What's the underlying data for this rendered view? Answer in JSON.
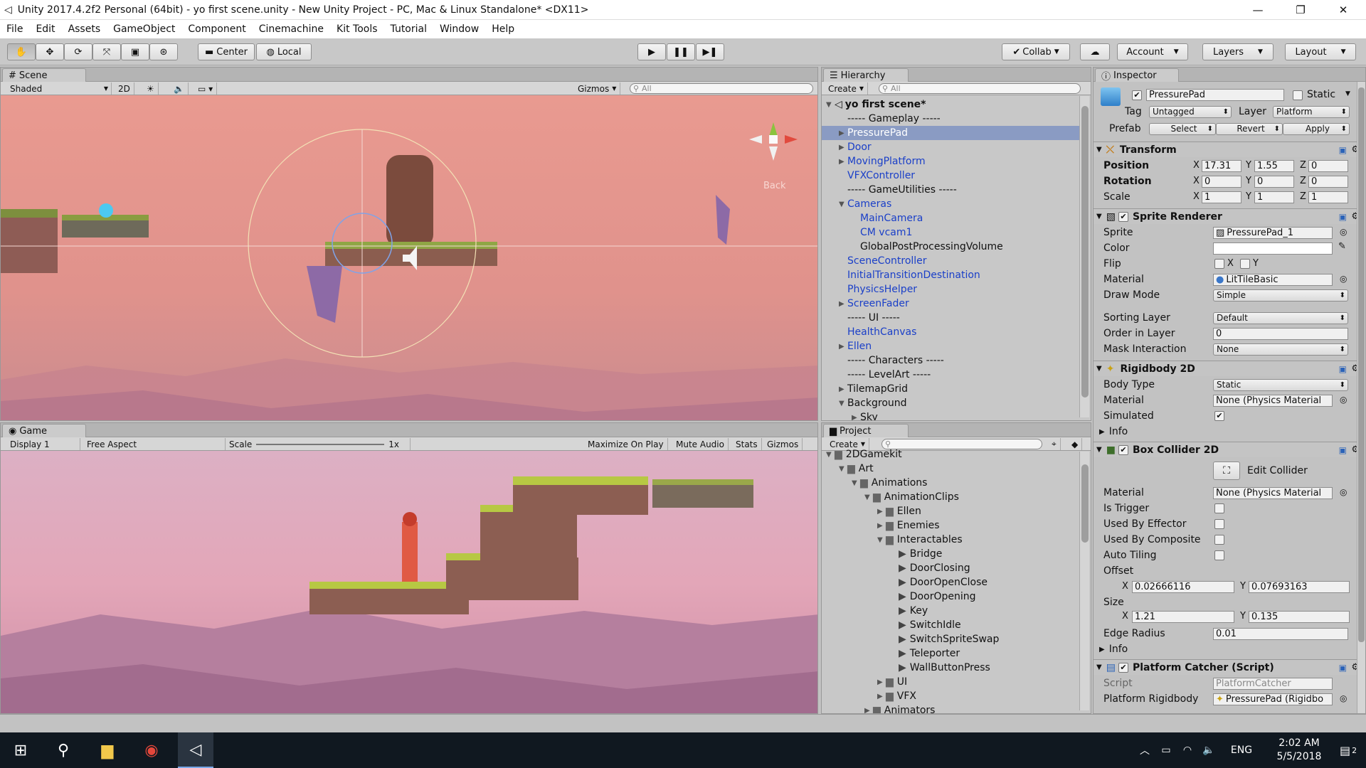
{
  "window": {
    "title": "Unity 2017.4.2f2 Personal (64bit) - yo first scene.unity - New Unity Project - PC, Mac & Linux Standalone* <DX11>"
  },
  "menu": [
    "File",
    "Edit",
    "Assets",
    "GameObject",
    "Component",
    "Cinemachine",
    "Kit Tools",
    "Tutorial",
    "Window",
    "Help"
  ],
  "toolbar": {
    "center": "Center",
    "local": "Local",
    "collab": "Collab",
    "account": "Account",
    "layers": "Layers",
    "layout": "Layout"
  },
  "scene": {
    "tab": "Scene",
    "shading": "Shaded",
    "mode2d": "2D",
    "gizmos": "Gizmos",
    "search_placeholder": "All",
    "back_label": "Back"
  },
  "game": {
    "tab": "Game",
    "display": "Display 1",
    "aspect": "Free Aspect",
    "scale_label": "Scale",
    "scale_value": "1x",
    "maximize": "Maximize On Play",
    "mute": "Mute Audio",
    "stats": "Stats",
    "gizmos": "Gizmos"
  },
  "hierarchy": {
    "tab": "Hierarchy",
    "create": "Create",
    "search_placeholder": "All",
    "scene_name": "yo first scene*",
    "items": [
      {
        "label": "----- Gameplay -----",
        "indent": 1,
        "arrow": "",
        "style": "plain"
      },
      {
        "label": "PressurePad",
        "indent": 1,
        "arrow": "▶",
        "style": "selected"
      },
      {
        "label": "Door",
        "indent": 1,
        "arrow": "▶",
        "style": "blue"
      },
      {
        "label": "MovingPlatform",
        "indent": 1,
        "arrow": "▶",
        "style": "blue"
      },
      {
        "label": "VFXController",
        "indent": 1,
        "arrow": "",
        "style": "blue"
      },
      {
        "label": "----- GameUtilities -----",
        "indent": 1,
        "arrow": "",
        "style": "plain"
      },
      {
        "label": "Cameras",
        "indent": 1,
        "arrow": "▼",
        "style": "blue"
      },
      {
        "label": "MainCamera",
        "indent": 2,
        "arrow": "",
        "style": "blue"
      },
      {
        "label": "CM vcam1",
        "indent": 2,
        "arrow": "",
        "style": "blue"
      },
      {
        "label": "GlobalPostProcessingVolume",
        "indent": 2,
        "arrow": "",
        "style": "plain"
      },
      {
        "label": "SceneController",
        "indent": 1,
        "arrow": "",
        "style": "blue"
      },
      {
        "label": "InitialTransitionDestination",
        "indent": 1,
        "arrow": "",
        "style": "blue"
      },
      {
        "label": "PhysicsHelper",
        "indent": 1,
        "arrow": "",
        "style": "blue"
      },
      {
        "label": "ScreenFader",
        "indent": 1,
        "arrow": "▶",
        "style": "blue"
      },
      {
        "label": "----- UI -----",
        "indent": 1,
        "arrow": "",
        "style": "plain"
      },
      {
        "label": "HealthCanvas",
        "indent": 1,
        "arrow": "",
        "style": "blue"
      },
      {
        "label": "Ellen",
        "indent": 1,
        "arrow": "▶",
        "style": "blue"
      },
      {
        "label": "----- Characters -----",
        "indent": 1,
        "arrow": "",
        "style": "plain"
      },
      {
        "label": "----- LevelArt -----",
        "indent": 1,
        "arrow": "",
        "style": "plain"
      },
      {
        "label": "TilemapGrid",
        "indent": 1,
        "arrow": "▶",
        "style": "plain"
      },
      {
        "label": "Background",
        "indent": 1,
        "arrow": "▼",
        "style": "plain"
      },
      {
        "label": "Sky",
        "indent": 2,
        "arrow": "▶",
        "style": "plain"
      }
    ]
  },
  "project": {
    "tab": "Project",
    "create": "Create",
    "items": [
      {
        "label": "2DGamekit",
        "indent": 0,
        "arrow": "▼",
        "icon": "folder"
      },
      {
        "label": "Art",
        "indent": 1,
        "arrow": "▼",
        "icon": "folder"
      },
      {
        "label": "Animations",
        "indent": 2,
        "arrow": "▼",
        "icon": "folder"
      },
      {
        "label": "AnimationClips",
        "indent": 3,
        "arrow": "▼",
        "icon": "folder"
      },
      {
        "label": "Ellen",
        "indent": 4,
        "arrow": "▶",
        "icon": "folder"
      },
      {
        "label": "Enemies",
        "indent": 4,
        "arrow": "▶",
        "icon": "folder"
      },
      {
        "label": "Interactables",
        "indent": 4,
        "arrow": "▼",
        "icon": "folder"
      },
      {
        "label": "Bridge",
        "indent": 5,
        "arrow": "",
        "icon": "clip"
      },
      {
        "label": "DoorClosing",
        "indent": 5,
        "arrow": "",
        "icon": "clip"
      },
      {
        "label": "DoorOpenClose",
        "indent": 5,
        "arrow": "",
        "icon": "clip"
      },
      {
        "label": "DoorOpening",
        "indent": 5,
        "arrow": "",
        "icon": "clip"
      },
      {
        "label": "Key",
        "indent": 5,
        "arrow": "",
        "icon": "clip"
      },
      {
        "label": "SwitchIdle",
        "indent": 5,
        "arrow": "",
        "icon": "clip"
      },
      {
        "label": "SwitchSpriteSwap",
        "indent": 5,
        "arrow": "",
        "icon": "clip"
      },
      {
        "label": "Teleporter",
        "indent": 5,
        "arrow": "",
        "icon": "clip"
      },
      {
        "label": "WallButtonPress",
        "indent": 5,
        "arrow": "",
        "icon": "clip"
      },
      {
        "label": "UI",
        "indent": 4,
        "arrow": "▶",
        "icon": "folder"
      },
      {
        "label": "VFX",
        "indent": 4,
        "arrow": "▶",
        "icon": "folder"
      },
      {
        "label": "Animators",
        "indent": 3,
        "arrow": "▶",
        "icon": "folder"
      }
    ]
  },
  "inspector": {
    "tab": "Inspector",
    "object_name": "PressurePad",
    "static_label": "Static",
    "tag_label": "Tag",
    "tag_value": "Untagged",
    "layer_label": "Layer",
    "layer_value": "Platform",
    "prefab_label": "Prefab",
    "select": "Select",
    "revert": "Revert",
    "apply": "Apply",
    "transform": {
      "title": "Transform",
      "position_label": "Position",
      "pos_x": "17.31",
      "pos_y": "1.55",
      "pos_z": "0",
      "rotation_label": "Rotation",
      "rot_x": "0",
      "rot_y": "0",
      "rot_z": "0",
      "scale_label": "Scale",
      "scale_x": "1",
      "scale_y": "1",
      "scale_z": "1"
    },
    "sprite_renderer": {
      "title": "Sprite Renderer",
      "sprite_label": "Sprite",
      "sprite_value": "PressurePad_1",
      "color_label": "Color",
      "flip_label": "Flip",
      "flip_x": "X",
      "flip_y": "Y",
      "material_label": "Material",
      "material_value": "LitTileBasic",
      "draw_mode_label": "Draw Mode",
      "draw_mode_value": "Simple",
      "sorting_layer_label": "Sorting Layer",
      "sorting_layer_value": "Default",
      "order_label": "Order in Layer",
      "order_value": "0",
      "mask_label": "Mask Interaction",
      "mask_value": "None"
    },
    "rigidbody": {
      "title": "Rigidbody 2D",
      "body_type_label": "Body Type",
      "body_type_value": "Static",
      "material_label": "Material",
      "material_value": "None (Physics Material",
      "simulated_label": "Simulated",
      "info_label": "Info"
    },
    "box_collider": {
      "title": "Box Collider 2D",
      "edit_collider": "Edit Collider",
      "material_label": "Material",
      "material_value": "None (Physics Material",
      "is_trigger_label": "Is Trigger",
      "used_by_effector_label": "Used By Effector",
      "used_by_composite_label": "Used By Composite",
      "auto_tiling_label": "Auto Tiling",
      "offset_label": "Offset",
      "offset_x": "0.02666116",
      "offset_y": "0.07693163",
      "size_label": "Size",
      "size_x": "1.21",
      "size_y": "0.135",
      "edge_radius_label": "Edge Radius",
      "edge_radius_value": "0.01",
      "info_label": "Info"
    },
    "platform_catcher": {
      "title": "Platform Catcher (Script)",
      "script_label": "Script",
      "script_value": "PlatformCatcher",
      "platform_rb_label": "Platform Rigidbody",
      "platform_rb_value": "PressurePad (Rigidbo"
    }
  },
  "taskbar": {
    "lang": "ENG",
    "time": "2:02 AM",
    "date": "5/5/2018",
    "notif_count": "2"
  },
  "colors": {
    "scene_bg": "#e3918a",
    "selection": "#8a9bc3",
    "hier_blue": "#1a3fc8"
  }
}
